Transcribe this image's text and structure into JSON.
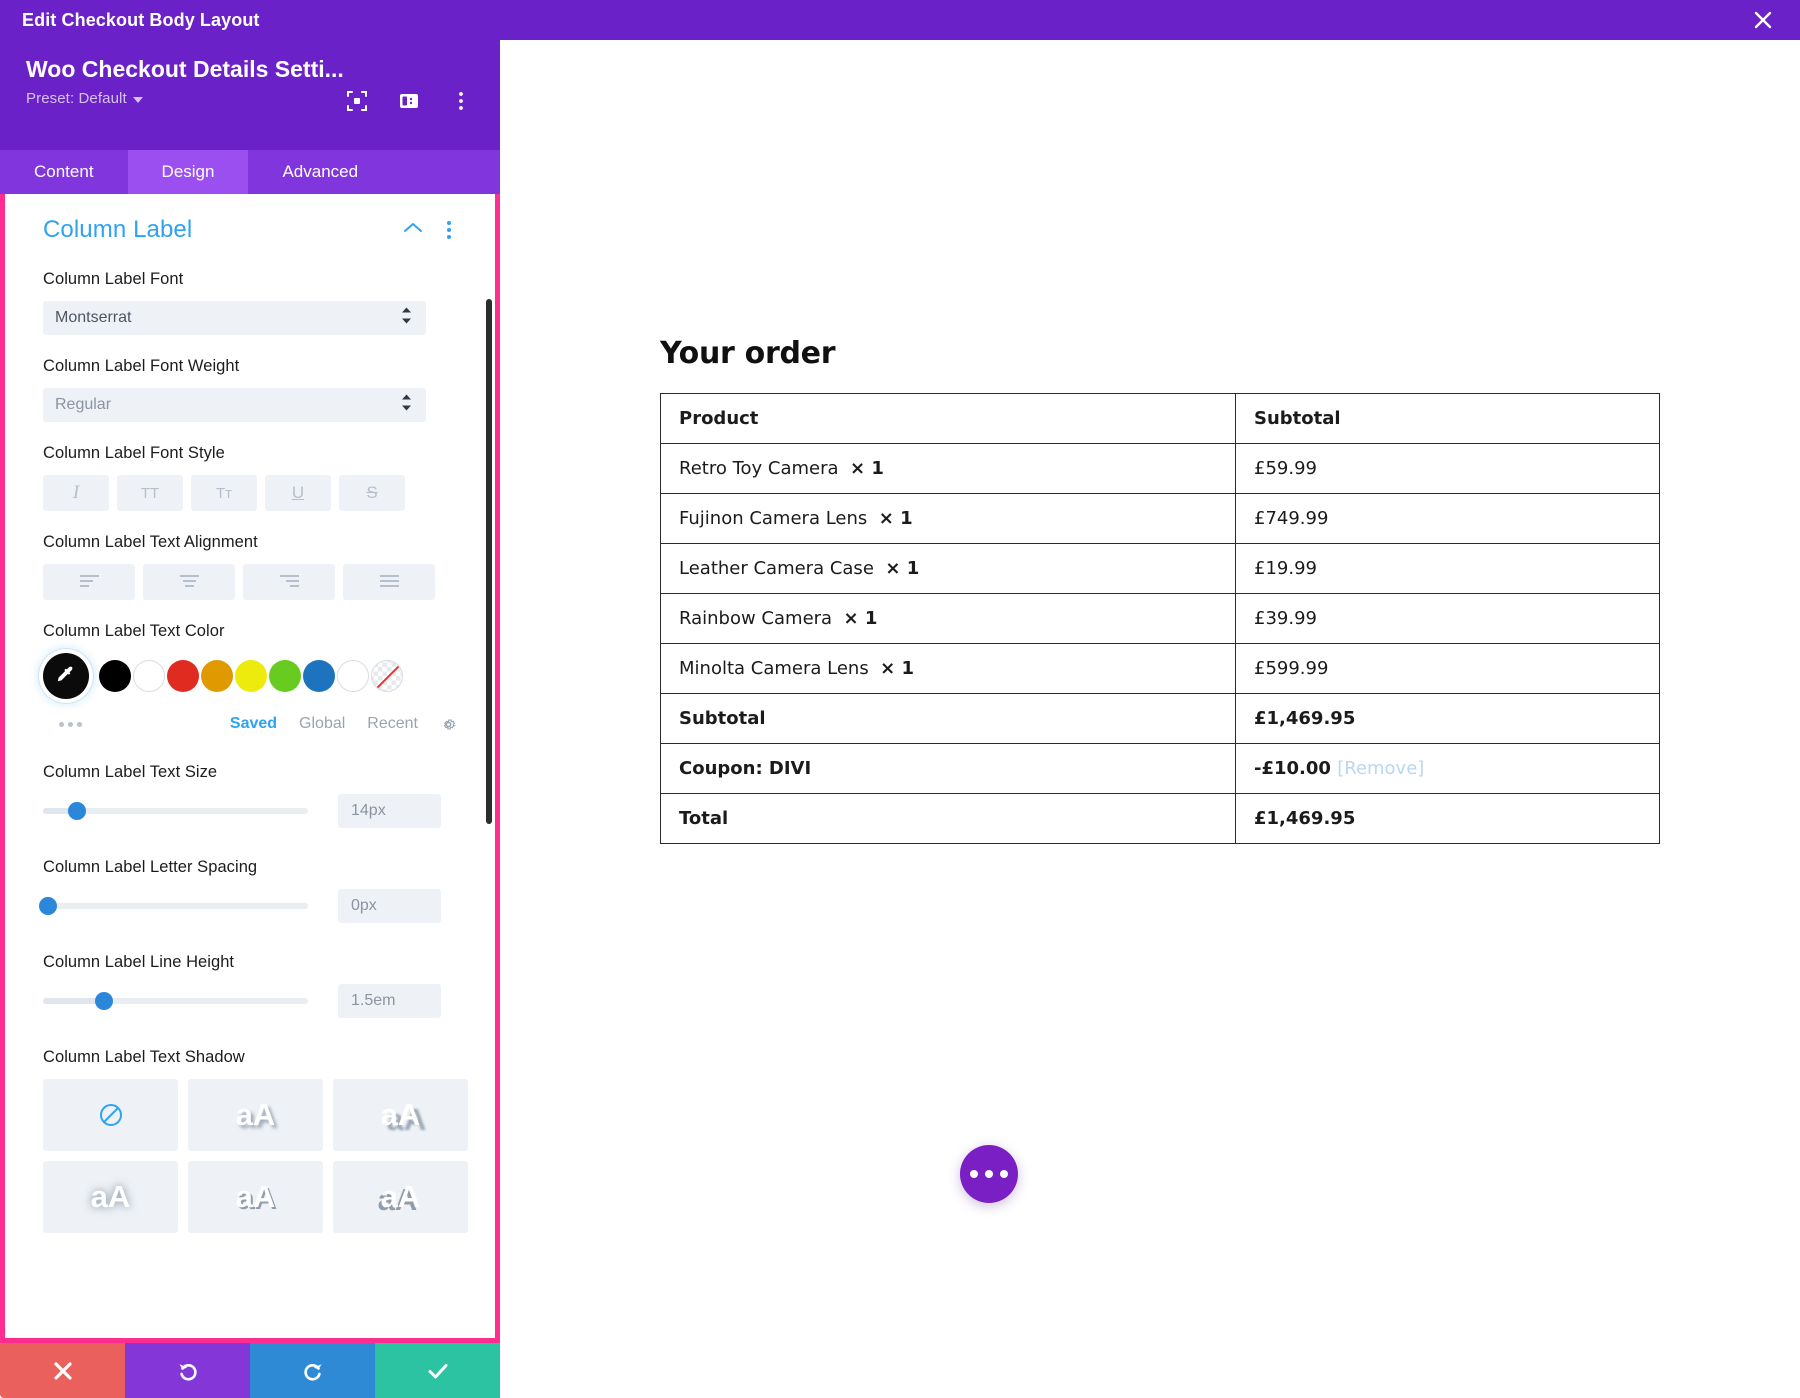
{
  "topbar": {
    "title": "Edit Checkout Body Layout",
    "close_icon": "close-icon"
  },
  "modal": {
    "module_title": "Woo Checkout Details Setti...",
    "preset_label": "Preset: Default",
    "tabs": [
      {
        "label": "Content",
        "active": false
      },
      {
        "label": "Design",
        "active": true
      },
      {
        "label": "Advanced",
        "active": false
      }
    ],
    "section": {
      "title": "Column Label"
    },
    "fields": {
      "font": {
        "label": "Column Label Font",
        "value": "Montserrat"
      },
      "font_weight": {
        "label": "Column Label Font Weight",
        "value": "Regular"
      },
      "font_style": {
        "label": "Column Label Font Style",
        "buttons": [
          "I",
          "TT",
          "Tᴛ",
          "U",
          "S"
        ]
      },
      "text_alignment": {
        "label": "Column Label Text Alignment"
      },
      "text_color": {
        "label": "Column Label Text Color",
        "swatches": [
          "#000000",
          "#ffffff",
          "#e02b20",
          "#e09900",
          "#edeb0d",
          "#68cc20",
          "#1e73be",
          "#ffffff"
        ],
        "tabs": [
          {
            "label": "Saved",
            "active": true
          },
          {
            "label": "Global",
            "active": false
          },
          {
            "label": "Recent",
            "active": false
          }
        ]
      },
      "text_size": {
        "label": "Column Label Text Size",
        "value": "14px"
      },
      "letter_spacing": {
        "label": "Column Label Letter Spacing",
        "value": "0px"
      },
      "line_height": {
        "label": "Column Label Line Height",
        "value": "1.5em"
      },
      "text_shadow": {
        "label": "Column Label Text Shadow",
        "presets": [
          "none",
          "aA",
          "aA",
          "aA",
          "aA",
          "aA"
        ]
      }
    },
    "actions": {
      "cancel": "cancel-changes-button",
      "undo": "undo-button",
      "redo": "redo-button",
      "save": "save-changes-button"
    }
  },
  "preview": {
    "heading": "Your order",
    "table": {
      "headers": [
        "Product",
        "Subtotal"
      ],
      "rows": [
        {
          "name": "Retro Toy Camera",
          "qty": "× 1",
          "subtotal": "£59.99",
          "bold": false
        },
        {
          "name": "Fujinon Camera Lens",
          "qty": "× 1",
          "subtotal": "£749.99",
          "bold": false
        },
        {
          "name": "Leather Camera Case",
          "qty": "× 1",
          "subtotal": "£19.99",
          "bold": false
        },
        {
          "name": "Rainbow Camera",
          "qty": "× 1",
          "subtotal": "£39.99",
          "bold": false
        },
        {
          "name": "Minolta Camera Lens",
          "qty": "× 1",
          "subtotal": "£599.99",
          "bold": false
        }
      ],
      "totals": [
        {
          "label": "Subtotal",
          "value": "£1,469.95",
          "extra": ""
        },
        {
          "label": "Coupon: DIVI",
          "value": "-£10.00",
          "extra": "[Remove]"
        },
        {
          "label": "Total",
          "value": "£1,469.95",
          "extra": ""
        }
      ]
    },
    "fab": "more-options-button"
  },
  "colors": {
    "purple_bar": "#6b21c8",
    "tab_active": "#9b4ff0",
    "accent_blue": "#2ea3f2",
    "highlight_pink": "#ff2d8f"
  }
}
